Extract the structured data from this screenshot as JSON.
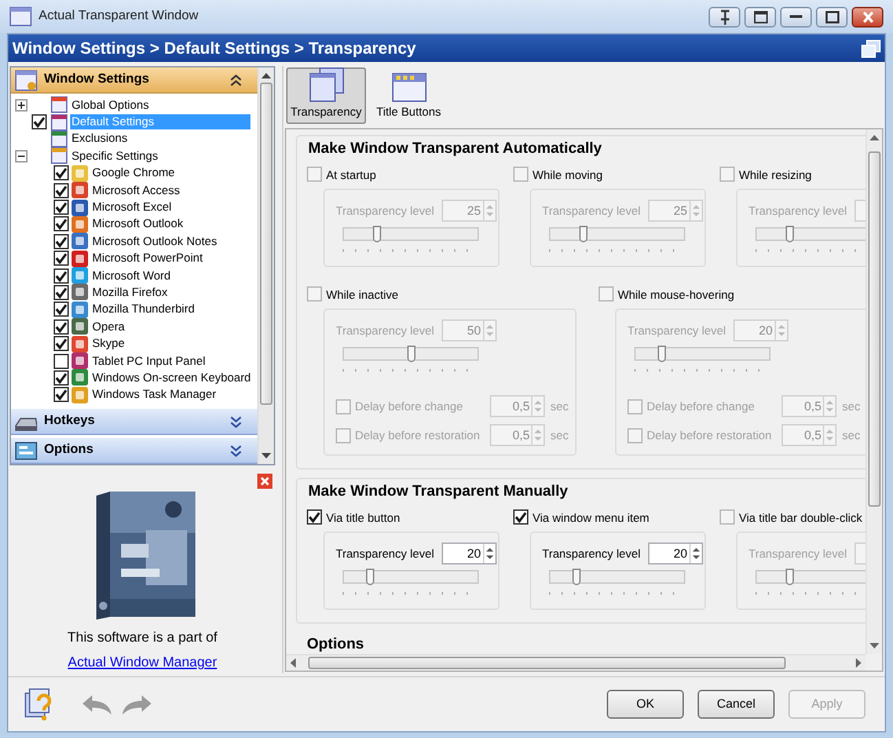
{
  "window": {
    "title": "Actual Transparent Window"
  },
  "breadcrumb": "Window Settings > Default Settings > Transparency",
  "sidebar": {
    "panels": [
      {
        "title": "Window Settings",
        "expanded": true,
        "tree": [
          {
            "label": "Global Options",
            "expanded": false,
            "selected": false
          },
          {
            "label": "Default Settings",
            "checked": true,
            "selected": true
          },
          {
            "label": "Exclusions",
            "selected": false
          },
          {
            "label": "Specific Settings",
            "expanded": true,
            "selected": false,
            "children": [
              {
                "label": "Google Chrome",
                "checked": true,
                "selected": false
              },
              {
                "label": "Microsoft Access",
                "checked": true,
                "selected": false
              },
              {
                "label": "Microsoft Excel",
                "checked": true,
                "selected": false
              },
              {
                "label": "Microsoft Outlook",
                "checked": true,
                "selected": false
              },
              {
                "label": "Microsoft Outlook Notes",
                "checked": true,
                "selected": false
              },
              {
                "label": "Microsoft PowerPoint",
                "checked": true,
                "selected": false
              },
              {
                "label": "Microsoft Word",
                "checked": true,
                "selected": false
              },
              {
                "label": "Mozilla Firefox",
                "checked": true,
                "selected": false
              },
              {
                "label": "Mozilla Thunderbird",
                "checked": true,
                "selected": false
              },
              {
                "label": "Opera",
                "checked": true,
                "selected": false
              },
              {
                "label": "Skype",
                "checked": true,
                "selected": false
              },
              {
                "label": "Tablet PC Input Panel",
                "checked": false,
                "selected": false
              },
              {
                "label": "Windows On-screen Keyboard",
                "checked": true,
                "selected": false
              },
              {
                "label": "Windows Task Manager",
                "checked": true,
                "selected": false
              }
            ]
          }
        ]
      },
      {
        "title": "Hotkeys",
        "expanded": false
      },
      {
        "title": "Options",
        "expanded": false
      }
    ]
  },
  "promo": {
    "kind": "picture",
    "text": "This software is a part of",
    "link": "Actual Window Manager"
  },
  "tabs": [
    {
      "label": "Transparency",
      "selected": true
    },
    {
      "label": "Title Buttons",
      "selected": false
    }
  ],
  "sections": [
    {
      "title": "Make Window Transparent Automatically",
      "rows": [
        [
          {
            "label": "At startup",
            "checked": false,
            "caption": "Transparency level",
            "value": "25",
            "level": 0.25
          },
          {
            "label": "While moving",
            "checked": false,
            "caption": "Transparency level",
            "value": "25",
            "level": 0.25
          },
          {
            "label": "While resizing",
            "checked": false,
            "caption": "Transparency level",
            "level": 0.25
          }
        ],
        [
          {
            "label": "While inactive",
            "checked": false,
            "caption": "Transparency level",
            "value": "50",
            "level": 0.5,
            "delays": [
              {
                "label": "Delay before change",
                "checked": false,
                "value": "0,5",
                "unit": "sec"
              },
              {
                "label": "Delay before restoration",
                "checked": false,
                "value": "0,5",
                "unit": "sec"
              }
            ]
          },
          {
            "label": "While mouse-hovering",
            "checked": false,
            "caption": "Transparency level",
            "value": "20",
            "level": 0.2,
            "delays": [
              {
                "label": "Delay before change",
                "checked": false,
                "value": "0,5",
                "unit": "sec"
              },
              {
                "label": "Delay before restoration",
                "checked": false,
                "value": "0,5",
                "unit": "sec"
              }
            ]
          }
        ]
      ]
    },
    {
      "title": "Make Window Transparent Manually",
      "rows": [
        [
          {
            "label": "Via title button",
            "checked": true,
            "caption": "Transparency level",
            "value": "20",
            "level": 0.2
          },
          {
            "label": "Via window menu item",
            "checked": true,
            "caption": "Transparency level",
            "value": "20",
            "level": 0.2
          },
          {
            "label": "Via title bar double-click",
            "checked": false,
            "caption": "Transparency level",
            "level": 0.25
          }
        ]
      ]
    },
    {
      "title": "Options"
    }
  ],
  "buttons": [
    {
      "label": "OK",
      "disabled": false
    },
    {
      "label": "Cancel",
      "disabled": false
    },
    {
      "label": "Apply",
      "disabled": true
    }
  ]
}
